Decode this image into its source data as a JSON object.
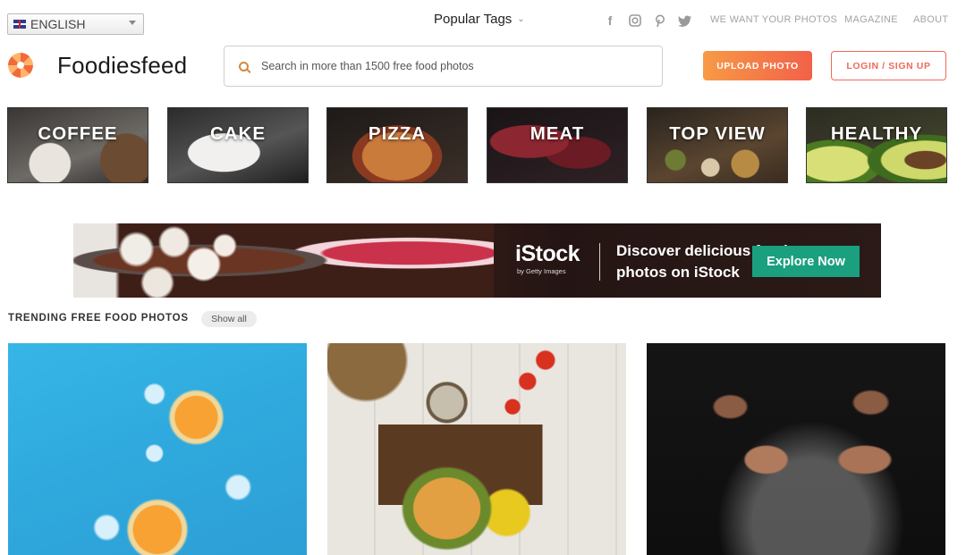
{
  "topbar": {
    "language": "ENGLISH",
    "popular_tags": "Popular Tags",
    "social_icons": [
      "facebook-icon",
      "instagram-icon",
      "pinterest-icon",
      "twitter-icon"
    ],
    "nav": [
      "WE WANT YOUR PHOTOS",
      "MAGAZINE",
      "ABOUT"
    ]
  },
  "header": {
    "brand": "Foodiesfeed",
    "search_placeholder": "Search in more than 1500 free food photos",
    "upload_label": "UPLOAD PHOTO",
    "login_label": "LOGIN / SIGN UP"
  },
  "categories": [
    "COFFEE",
    "CAKE",
    "PIZZA",
    "MEAT",
    "TOP VIEW",
    "HEALTHY"
  ],
  "ad": {
    "logo": "iStock",
    "logo_sub": "by Getty Images",
    "headline": "Discover delicious food photos on iStock",
    "button": "Explore Now"
  },
  "trending": {
    "title": "TRENDING FREE FOOD PHOTOS",
    "show_all": "Show all"
  },
  "colors": {
    "accent_orange": "#f79a46",
    "accent_red": "#ee6a5c",
    "istock_green": "#1a9f7f"
  }
}
